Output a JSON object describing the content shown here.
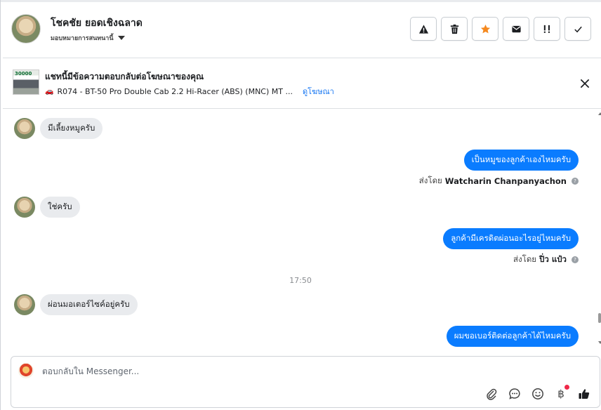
{
  "header": {
    "contact_name": "โชคชัย ยอดเชิงฉลาด",
    "assign_label": "มอบหมายการสนทนานี้"
  },
  "colors": {
    "accent": "#0a7cff",
    "star": "#f5891f",
    "link": "#1877f2",
    "notification": "#f02849"
  },
  "actions": [
    {
      "name": "spam-button",
      "icon": "warning-icon"
    },
    {
      "name": "delete-button",
      "icon": "trash-icon"
    },
    {
      "name": "star-button",
      "icon": "star-icon"
    },
    {
      "name": "mark-unread-button",
      "icon": "envelope-icon"
    },
    {
      "name": "follow-up-button",
      "icon": "flag-icon"
    },
    {
      "name": "done-button",
      "icon": "check-icon"
    }
  ],
  "ad": {
    "thumb_label": "30000",
    "title": "แชทนี้มีข้อความตอบกลับต่อโฆษณาของคุณ",
    "description": "R074 - BT-50 Pro Double Cab 2.2 Hi-Racer (ABS) (MNC) MT ...",
    "link": "ดูโฆษณา"
  },
  "messages": [
    {
      "direction": "in",
      "text": "มีเลี้ยงหมูครับ"
    },
    {
      "direction": "out",
      "text": "เป็นหมูของลูกค้าเองไหมครับ",
      "sent_by_label": "ส่งโดย",
      "sent_by": "Watcharin Chanpanyachon"
    },
    {
      "direction": "in",
      "text": "ใช่ครับ"
    },
    {
      "direction": "out",
      "text": "ลูกค้ามีเครดิตผ่อนอะไรอยู่ไหมครับ",
      "sent_by_label": "ส่งโดย",
      "sent_by": "ปิ่ว แป๋ว"
    },
    {
      "direction": "time",
      "text": "17:50"
    },
    {
      "direction": "in",
      "text": "ผ่อนมอเตอร์ไซค์อยู่ครับ"
    },
    {
      "direction": "out",
      "text": "ผมขอเบอร์ติดต่อลูกค้าได้ไหมครับ"
    }
  ],
  "composer": {
    "placeholder": "ตอบกลับใน Messenger...",
    "icons": [
      "paperclip-icon",
      "saved-reply-icon",
      "emoji-icon",
      "baht-icon",
      "thumbs-up-icon"
    ],
    "currency_symbol": "฿"
  }
}
